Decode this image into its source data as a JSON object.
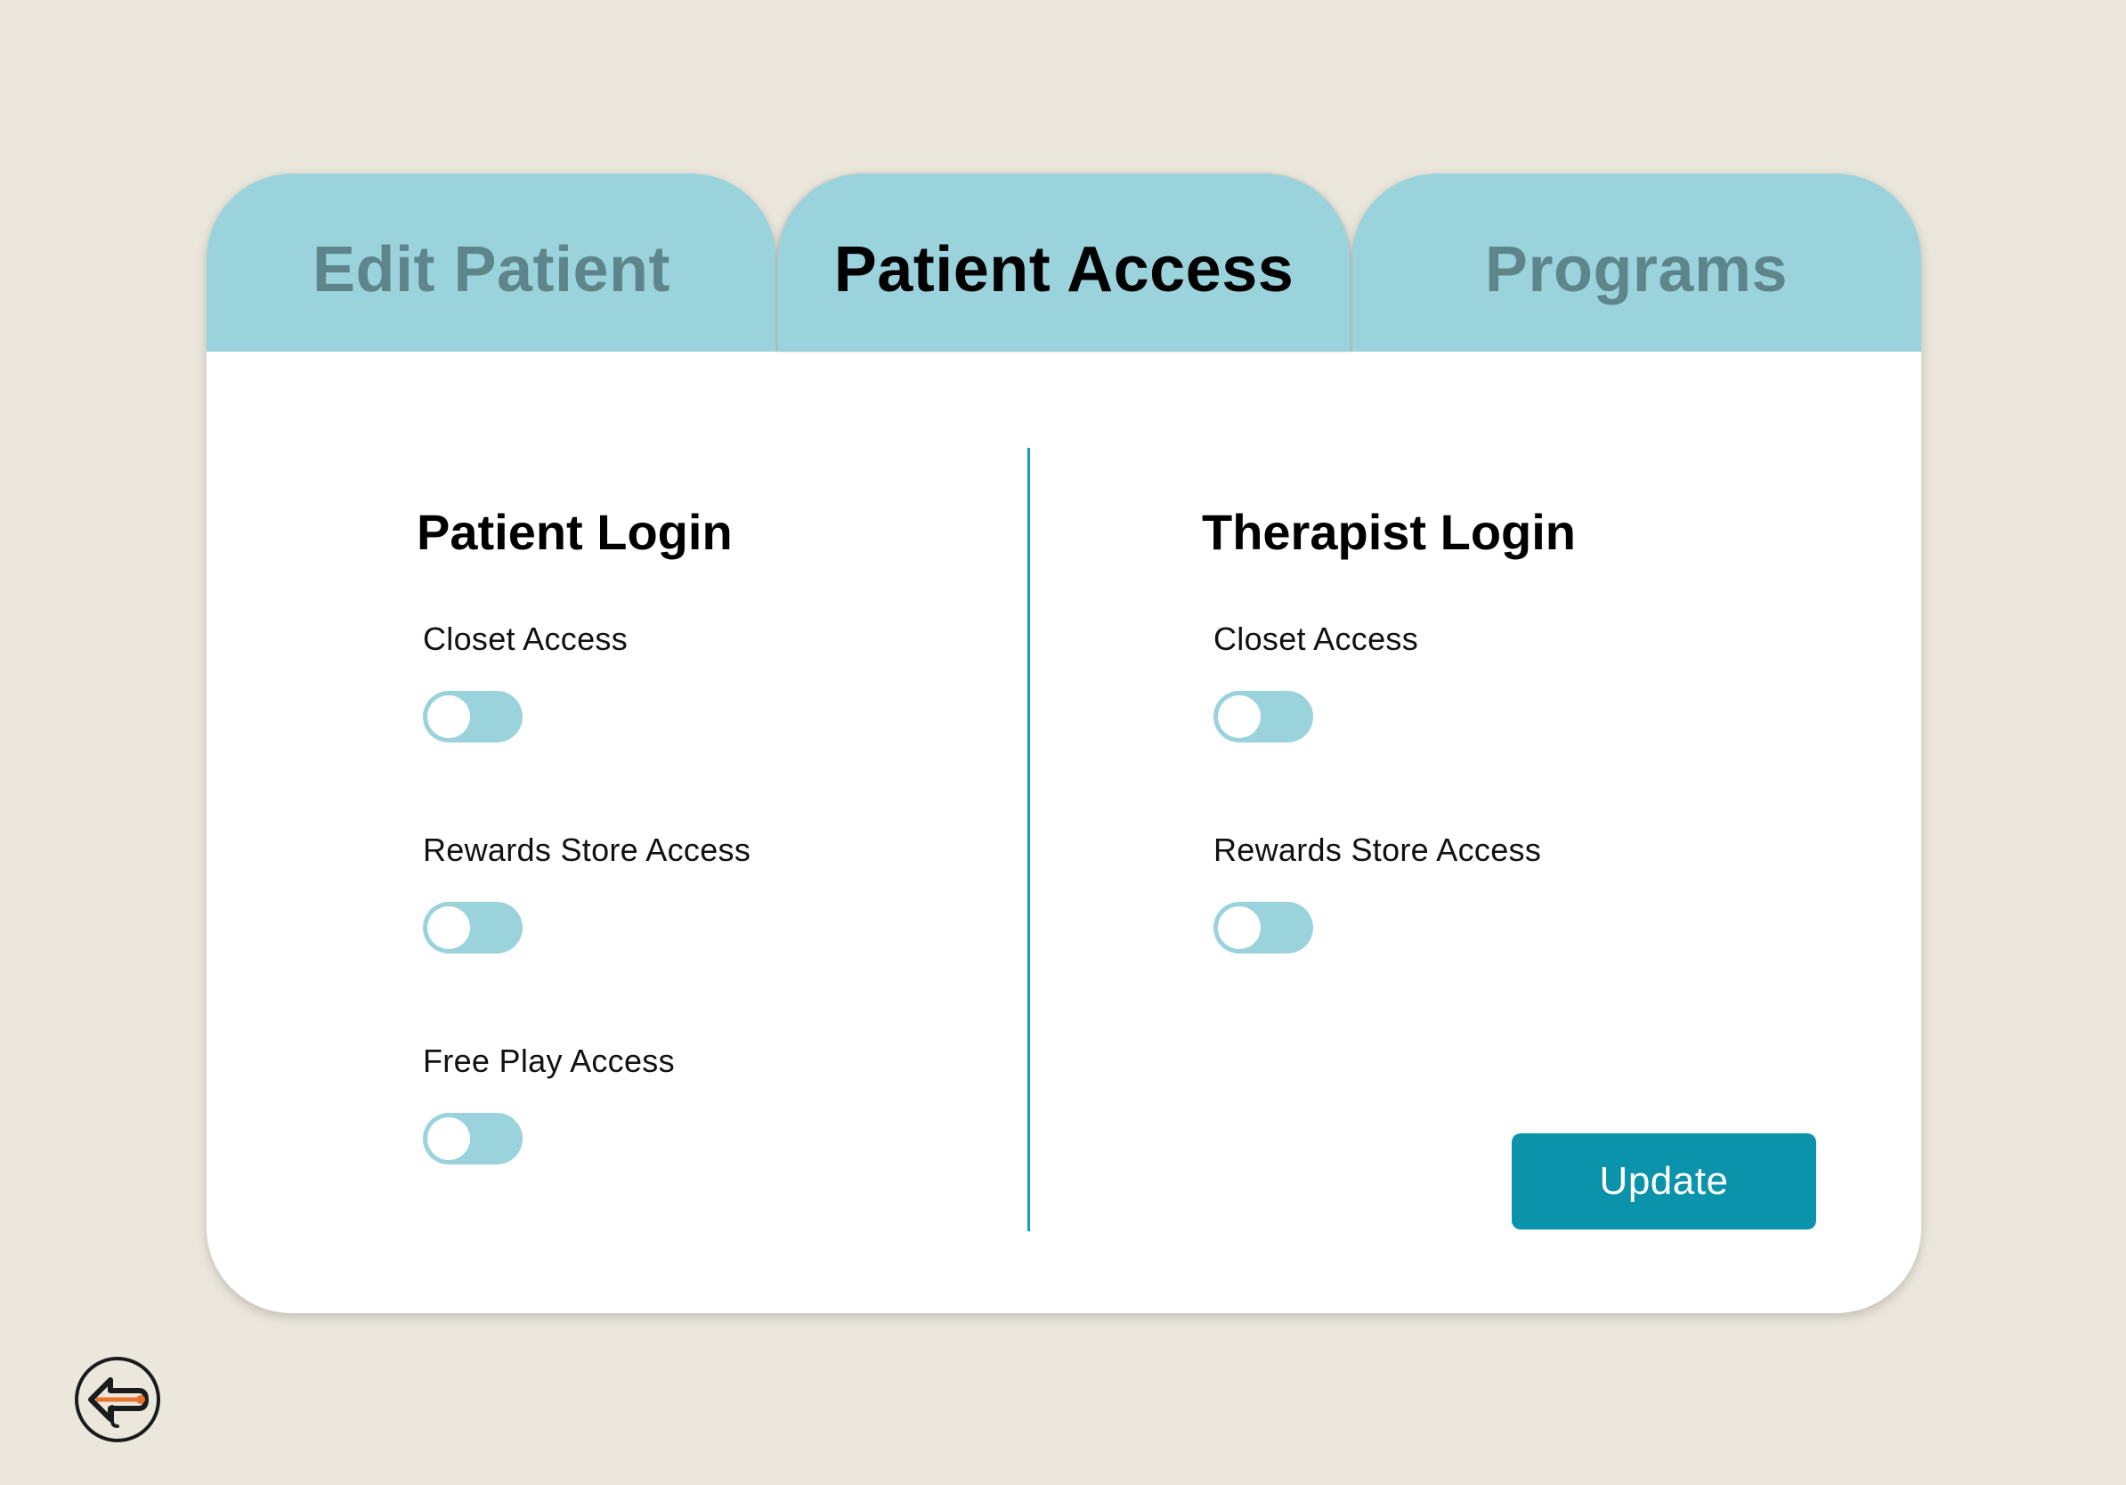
{
  "tabs": [
    {
      "label": "Edit Patient",
      "active": false
    },
    {
      "label": "Patient Access",
      "active": true
    },
    {
      "label": "Programs",
      "active": false
    }
  ],
  "patient_login": {
    "title": "Patient Login",
    "options": [
      {
        "label": "Closet Access",
        "enabled": false
      },
      {
        "label": "Rewards Store Access",
        "enabled": false
      },
      {
        "label": "Free Play Access",
        "enabled": false
      }
    ]
  },
  "therapist_login": {
    "title": "Therapist Login",
    "options": [
      {
        "label": "Closet Access",
        "enabled": false
      },
      {
        "label": "Rewards Store Access",
        "enabled": false
      }
    ]
  },
  "update_label": "Update",
  "back_icon": "back-arrow-icon",
  "colors": {
    "background": "#ebe7dc",
    "tab": "#9bd3dd",
    "inactive_tab_text": "#5e858c",
    "accent": "#0b93ab",
    "toggle_track": "#9bd3dd",
    "back_icon_accent": "#e8742c"
  }
}
